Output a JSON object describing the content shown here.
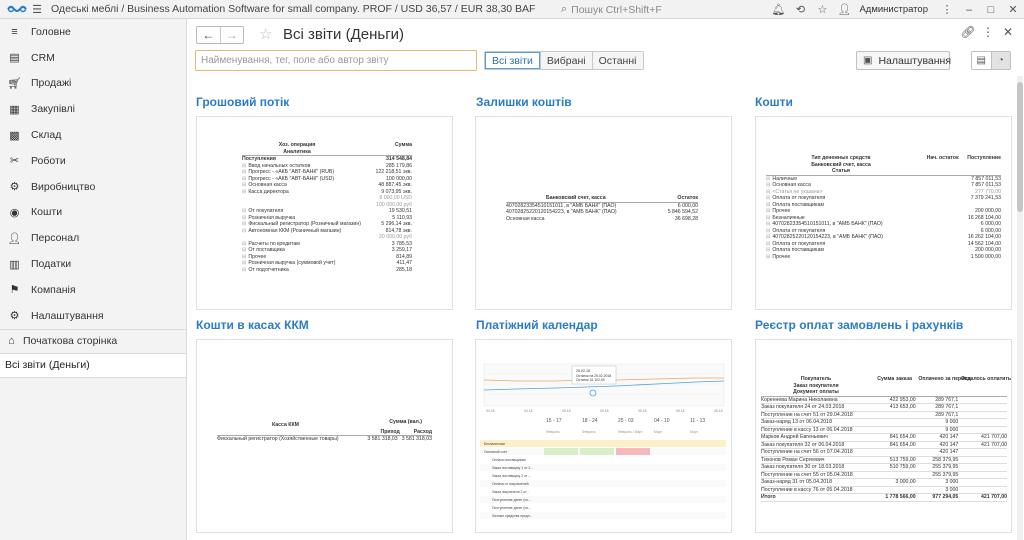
{
  "topbar": {
    "title": "Одеські меблі / Business Automation Software for small company. PROF / USD 36,57 / EUR 38,30 BAF",
    "search_placeholder": "Пошук Ctrl+Shift+F",
    "user": "Администратор"
  },
  "sidebar": {
    "items": [
      {
        "label": "Головне",
        "icon": "menu-lines-icon"
      },
      {
        "label": "CRM",
        "icon": "crm-icon"
      },
      {
        "label": "Продажі",
        "icon": "cart-icon"
      },
      {
        "label": "Закупівлі",
        "icon": "purchases-icon"
      },
      {
        "label": "Склад",
        "icon": "warehouse-icon"
      },
      {
        "label": "Роботи",
        "icon": "tools-icon"
      },
      {
        "label": "Виробництво",
        "icon": "production-icon"
      },
      {
        "label": "Кошти",
        "icon": "money-icon"
      },
      {
        "label": "Персонал",
        "icon": "person-icon"
      },
      {
        "label": "Податки",
        "icon": "taxes-icon"
      },
      {
        "label": "Компанія",
        "icon": "flag-icon"
      },
      {
        "label": "Налаштування",
        "icon": "gear-icon"
      }
    ],
    "home": "Початкова сторінка",
    "open_tab": "Всі звіти (Деньги)"
  },
  "main": {
    "title": "Всі звіти (Деньги)",
    "search_placeholder": "Найменування, тег, поле або автор звіту",
    "filters": [
      "Всі звіти",
      "Вибрані",
      "Останні"
    ],
    "settings_label": "Налаштування",
    "reports": [
      {
        "title": "Грошовий потік"
      },
      {
        "title": "Залишки коштів"
      },
      {
        "title": "Кошти"
      },
      {
        "title": "Кошти в касах ККМ"
      },
      {
        "title": "Платіжний календар"
      },
      {
        "title": "Реєстр оплат замовлень і рахунків"
      }
    ]
  },
  "previews": {
    "cashflow": {
      "h1": "Хоз. операция",
      "h2": "Аналитика",
      "h3": "Сумма",
      "rows": [
        {
          "label": "Поступления",
          "value": "314 548,84",
          "bold": true
        },
        {
          "label": "Ввод начальных остатков",
          "value": "285 179,86"
        },
        {
          "label": "Прогресс - «АКБ \"АВТ-БАНК\" (RUB)",
          "value": "122 218,51 экв."
        },
        {
          "label": "Прогресс - «АКБ \"АВТ-БАНК\" (USD)",
          "value": "100 000,00"
        },
        {
          "label": "Основная касса",
          "value": "48 887,45 экв."
        },
        {
          "label": "Касса директора",
          "value": "9 073,95 экв."
        },
        {
          "label": "",
          "value": "9 000,00 USD",
          "grey": true
        },
        {
          "label": "",
          "value": "100 000,00 руб",
          "grey": true
        },
        {
          "label": "От покупателя",
          "value": "19 530,51"
        },
        {
          "label": "Розничная выручка",
          "value": "5 110,93"
        },
        {
          "label": "Фискальный регистратор (Розничный магазин)",
          "value": "5 296,14 экв."
        },
        {
          "label": "Автономная ККМ (Розничный магазин)",
          "value": "814,78 экв."
        },
        {
          "label": "",
          "value": "20 000,00 руб",
          "grey": true
        },
        {
          "label": "Расчеты по кредитам",
          "value": "3 785,53"
        },
        {
          "label": "От поставщика",
          "value": "3 259,17"
        },
        {
          "label": "Прочее",
          "value": "814,89"
        },
        {
          "label": "Розничная выручка (суммовой учет)",
          "value": "411,47"
        },
        {
          "label": "От подотчетника",
          "value": "285,18"
        }
      ]
    },
    "balances": {
      "h1": "Банковский счет, касса",
      "h2": "Остаток",
      "rows": [
        {
          "label": "40702823354510151011, в \"АМБ БАНК\" (ПАО)",
          "value": "6 000,00"
        },
        {
          "label": "40702825220120154223, в \"АМБ БАНК\" (ПАО)",
          "value": "5 846 594,52"
        },
        {
          "label": "Основная касса",
          "value": "36 698,28"
        }
      ]
    },
    "funds": {
      "h1": "Тип денежных средств",
      "h2": "Банковский счет, касса",
      "h3": "Статья",
      "h4": "Нач. остаток",
      "h5": "Поступление",
      "rows": [
        {
          "label": "Наличные",
          "value": "7 857 011,53"
        },
        {
          "label": "Основная касса",
          "value": "7 857 011,53"
        },
        {
          "label": "<Статья не указана>",
          "value": "277 770,00",
          "grey": true
        },
        {
          "label": "Оплата от покупателя",
          "value": "7 379 241,53"
        },
        {
          "label": "Оплата поставщикам",
          "value": ""
        },
        {
          "label": "Прочее",
          "value": "200 000,00"
        },
        {
          "label": "Безналичные",
          "value": "16 268 104,00"
        },
        {
          "label": "40702823354510151011, в \"АМБ БАНК\" (ПАО)",
          "value": "6 000,00"
        },
        {
          "label": "Оплата от покупателя",
          "value": "6 000,00"
        },
        {
          "label": "40702825220120154223, в \"АМБ БАНК\" (ПАО)",
          "value": "16 262 104,00"
        },
        {
          "label": "Оплата от покупателя",
          "value": "14 562 104,00"
        },
        {
          "label": "Оплата поставщикам",
          "value": "200 000,00"
        },
        {
          "label": "Прочее",
          "value": "1 500 000,00"
        }
      ]
    },
    "kkm": {
      "h1": "Касса ККМ",
      "h2": "Сумма (вал.)",
      "h3": "Приход",
      "h4": "Расход",
      "row_label": "Фискальный регистратор (Хозяйственные товары)",
      "row_in": "3 581 318,03",
      "row_out": "3 581 318,03"
    },
    "calendar": {
      "tooltip_date": "25.02.18",
      "tooltip_lines": [
        "Остаток на 25.02.2018",
        "Остаток 16 102,45"
      ],
      "x_ticks": [
        "04.18",
        "04.18",
        "05.18",
        "05.18",
        "05.18",
        "06.18",
        "06.18"
      ],
      "periods": [
        "15 - 17",
        "18 - 24",
        "25 - 03",
        "04 - 10",
        "11 - 13"
      ],
      "sub": [
        "Февраль",
        "Февраль",
        "Февраль / Март",
        "Март",
        "Март"
      ],
      "rows": [
        "Безналичные",
        "Основной счет",
        "Оплата поставщикам",
        "Заказ поставщику 1 от 2...",
        "Заказ поставщику 2 от ...",
        "Оплата от покупателей",
        "Заказ покупателя 2 от...",
        "Поступление денег (по...",
        "Поступление денег (по...",
        "Личные средства предп..."
      ]
    },
    "registry": {
      "h1": "Покупатель",
      "h2": "Заказ покупателя",
      "h3": "Документ оплаты",
      "h4": "Сумма заказа",
      "h5": "Оплачено за период",
      "h6": "Осталось оплатить / переплачено",
      "rows": [
        [
          "Кореннева Марина Николаевна",
          "422 953,00",
          "289 767,1",
          ""
        ],
        [
          "Заказ покупателя 24 от 24.03.2018",
          "413 653,00",
          "289 767,1",
          ""
        ],
        [
          "Поступление на счет 51 от 29.04.2018",
          "",
          "289 767,1",
          ""
        ],
        [
          "Заказ-наряд 13 от 06.04.2018",
          "",
          "9 000",
          ""
        ],
        [
          "Поступление в кассу 13 от 06.04.2018",
          "",
          "9 000",
          ""
        ],
        [
          "Марков Андрей Евгеньевич",
          "841 654,00",
          "420 147",
          "421 707,00"
        ],
        [
          "Заказ покупателя 32 от 06.04.2018",
          "841 654,00",
          "420 147",
          "421 707,00"
        ],
        [
          "Поступление на счет 56 от 07.04.2018",
          "",
          "420 147",
          ""
        ],
        [
          "Тихонов Роман Сергеевич",
          "513 759,00",
          "258 379,95",
          ""
        ],
        [
          "Заказ покупателя 30 от 18.03.2018",
          "510 759,00",
          "255 379,95",
          ""
        ],
        [
          "Поступление на счет 55 от 05.04.2018",
          "",
          "255 379,95",
          ""
        ],
        [
          "Заказ-наряд 31 от 05.04.2018",
          "3 000,00",
          "3 000",
          ""
        ],
        [
          "Поступление в кассу 76 от 05.04.2018",
          "",
          "3 000",
          ""
        ],
        [
          "Итого",
          "1 778 566,00",
          "977 294,05",
          "421 707,00"
        ]
      ]
    }
  }
}
